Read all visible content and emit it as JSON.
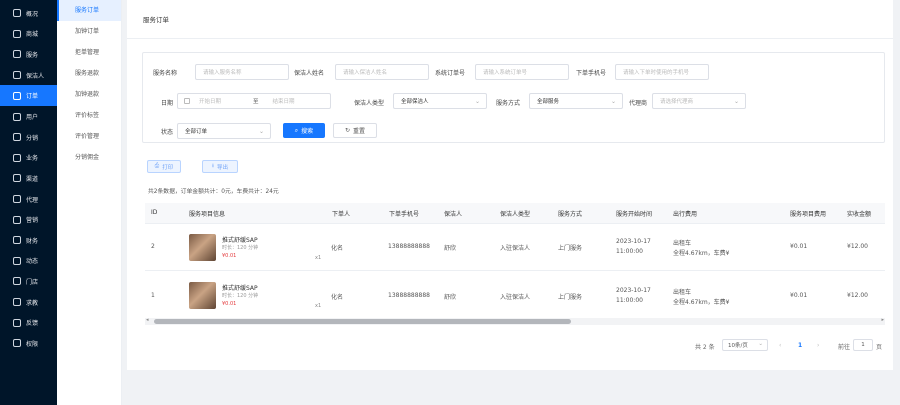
{
  "sidebar": {
    "items": [
      {
        "label": "概况",
        "icon": "home-icon"
      },
      {
        "label": "商城",
        "icon": "shop-icon"
      },
      {
        "label": "服务",
        "icon": "service-icon"
      },
      {
        "label": "保洁人",
        "icon": "cleaner-icon"
      },
      {
        "label": "订单",
        "icon": "order-icon",
        "active": true
      },
      {
        "label": "用户",
        "icon": "users-icon"
      },
      {
        "label": "分销",
        "icon": "distribution-icon"
      },
      {
        "label": "业务",
        "icon": "business-icon"
      },
      {
        "label": "渠道",
        "icon": "channel-icon"
      },
      {
        "label": "代理",
        "icon": "agent-icon"
      },
      {
        "label": "营销",
        "icon": "marketing-icon"
      },
      {
        "label": "财务",
        "icon": "finance-icon"
      },
      {
        "label": "动态",
        "icon": "feed-icon"
      },
      {
        "label": "门店",
        "icon": "store-icon"
      },
      {
        "label": "求教",
        "icon": "help-icon"
      },
      {
        "label": "反馈",
        "icon": "feedback-icon"
      },
      {
        "label": "权限",
        "icon": "permission-icon"
      }
    ]
  },
  "submenu": {
    "items": [
      {
        "label": "服务订单",
        "active": true
      },
      {
        "label": "加钟订单"
      },
      {
        "label": "拒单管理"
      },
      {
        "label": "服务退款"
      },
      {
        "label": "加钟退款"
      },
      {
        "label": "评价标签"
      },
      {
        "label": "评价管理"
      },
      {
        "label": "分销佣金"
      }
    ]
  },
  "page": {
    "title": "服务订单"
  },
  "filters": {
    "service_name": {
      "label": "服务名称",
      "placeholder": "请输入服务名称"
    },
    "cleaner_name": {
      "label": "保洁人姓名",
      "placeholder": "请输入保洁人姓名"
    },
    "order_no": {
      "label": "系统订单号",
      "placeholder": "请输入系统订单号"
    },
    "phone": {
      "label": "下单手机号",
      "placeholder": "请输入下单时使用的手机号"
    },
    "date": {
      "label": "日期",
      "start_placeholder": "开始日期",
      "separator": "至",
      "end_placeholder": "结束日期"
    },
    "cleaner_type": {
      "label": "保洁人类型",
      "value": "全部保洁人"
    },
    "service_mode": {
      "label": "服务方式",
      "value": "全部服务"
    },
    "agent": {
      "label": "代理商",
      "placeholder": "请选择代理商"
    },
    "status": {
      "label": "状态",
      "value": "全部订单"
    },
    "search_label": "搜索",
    "reset_label": "重置"
  },
  "actions": {
    "print_label": "打印",
    "export_label": "导出"
  },
  "summary": "共2条数据，订单金额共计：0元，车费共计：24元",
  "table": {
    "headers": [
      "ID",
      "服务项目信息",
      "下单人",
      "下单手机号",
      "保洁人",
      "保洁人类型",
      "服务方式",
      "服务开始时间",
      "出行费用",
      "服务项目费用",
      "实收金额"
    ],
    "rows": [
      {
        "id": "2",
        "service_name": "推式舒缓SAP",
        "duration": "时长：120 分钟",
        "price": "¥0.01",
        "qty": "x1",
        "customer": "化名",
        "phone": "13888888888",
        "cleaner": "舒欣",
        "cleaner_type": "入驻保洁人",
        "mode": "上门服务",
        "start_date": "2023-10-17",
        "start_time": "11:00:00",
        "travel_line1": "出租车",
        "travel_line2": "全程4.67km，车费¥",
        "item_fee": "¥0.01",
        "received": "¥12.00"
      },
      {
        "id": "1",
        "service_name": "推式舒缓SAP",
        "duration": "时长：120 分钟",
        "price": "¥0.01",
        "qty": "x1",
        "customer": "化名",
        "phone": "13888888888",
        "cleaner": "舒欣",
        "cleaner_type": "入驻保洁人",
        "mode": "上门服务",
        "start_date": "2023-10-17",
        "start_time": "11:00:00",
        "travel_line1": "出租车",
        "travel_line2": "全程4.67km，车费¥",
        "item_fee": "¥0.01",
        "received": "¥12.00"
      }
    ]
  },
  "pagination": {
    "total_text": "共 2 条",
    "page_size": "10条/页",
    "current_page": "1",
    "goto_label": "前往",
    "goto_value": "1",
    "page_suffix": "页"
  },
  "colors": {
    "primary": "#1677ff",
    "sidebar_bg": "#001529",
    "price": "#e4393c"
  }
}
